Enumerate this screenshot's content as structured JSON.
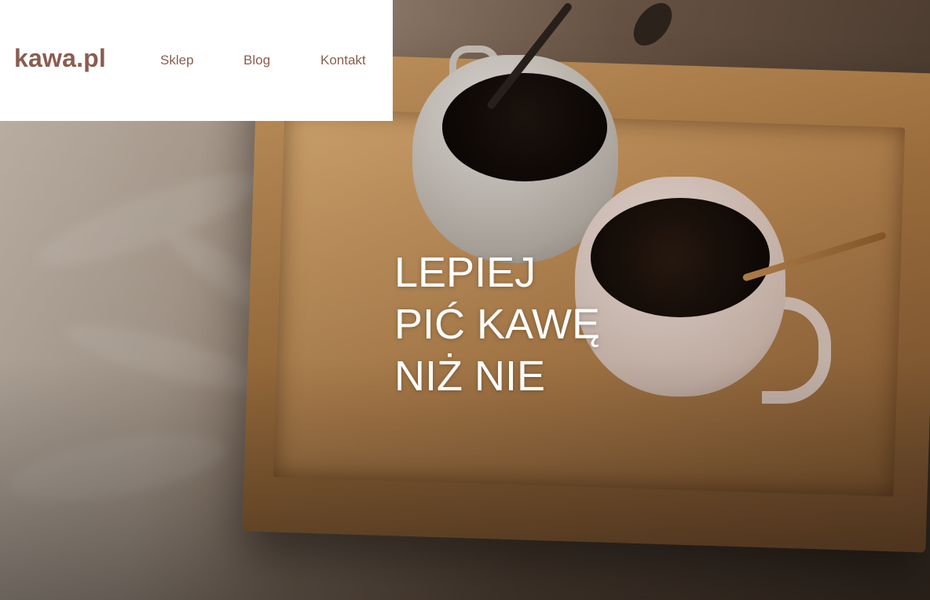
{
  "brand": {
    "logo_text": "kawa.pl",
    "color": "#8a5d4f"
  },
  "nav": {
    "items": [
      {
        "label": "Sklep"
      },
      {
        "label": "Blog"
      },
      {
        "label": "Kontakt"
      }
    ]
  },
  "hero": {
    "headline_lines": [
      "LEPIEJ",
      "PIĆ KAWĘ",
      "NIŻ NIE"
    ],
    "text_color": "#ffffff"
  }
}
